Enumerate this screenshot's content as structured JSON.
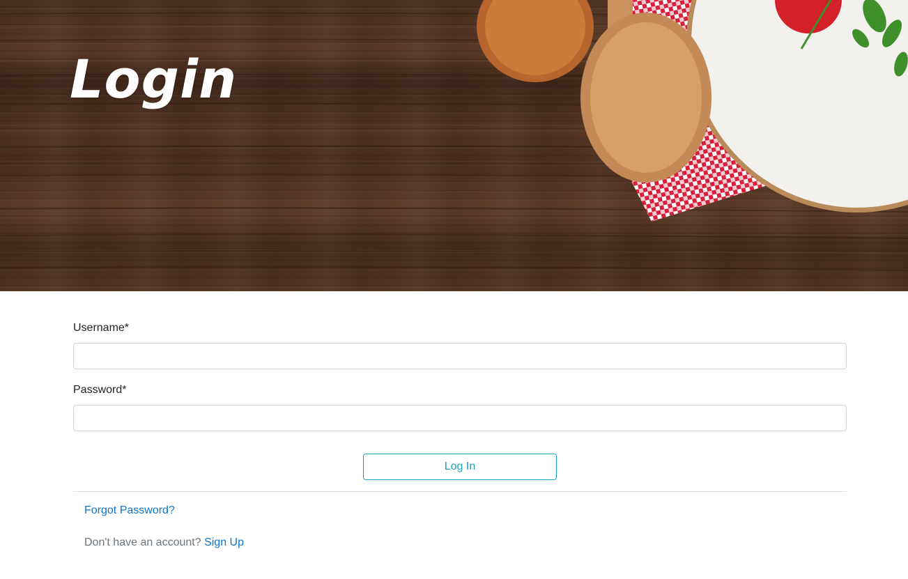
{
  "hero": {
    "title": "Login"
  },
  "form": {
    "username_label": "Username*",
    "username_value": "",
    "password_label": "Password*",
    "password_value": "",
    "submit_label": "Log In"
  },
  "links": {
    "forgot_password": "Forgot Password?",
    "no_account_text": "Don't have an account?",
    "sign_up": "Sign Up"
  },
  "colors": {
    "accent": "#17a2b8",
    "link": "#0d74c9",
    "muted_text": "#6c757d",
    "border": "#ced4da"
  }
}
